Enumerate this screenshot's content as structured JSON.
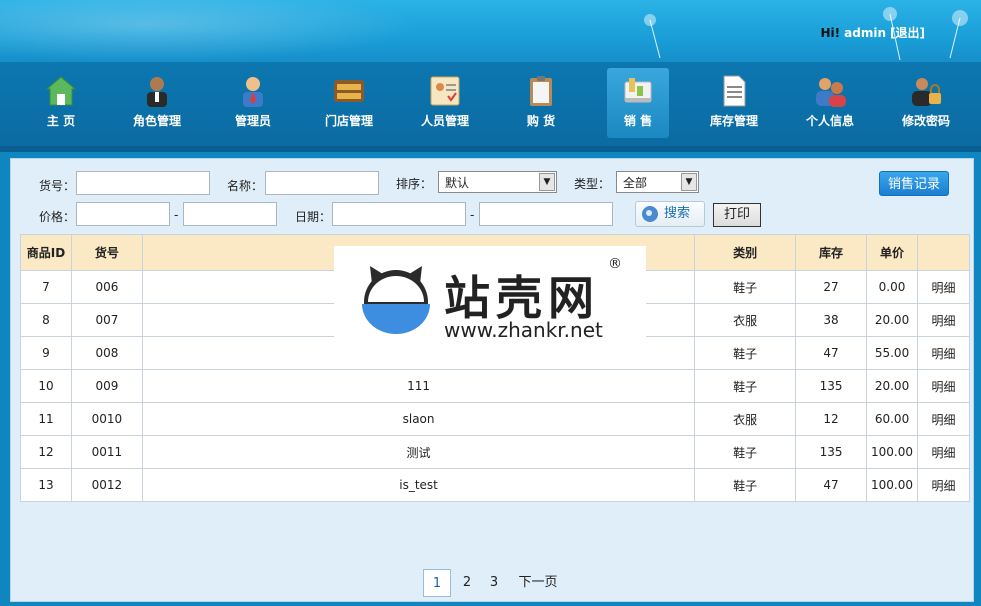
{
  "header": {
    "greeting": "Hi!",
    "username": "admin",
    "logout": "[退出]"
  },
  "nav": {
    "items": [
      {
        "label": "主  页",
        "icon": "home-icon",
        "active": false
      },
      {
        "label": "角色管理",
        "icon": "role-icon",
        "active": false
      },
      {
        "label": "管理员",
        "icon": "admin-icon",
        "active": false
      },
      {
        "label": "门店管理",
        "icon": "store-icon",
        "active": false
      },
      {
        "label": "人员管理",
        "icon": "staff-icon",
        "active": false
      },
      {
        "label": "购  货",
        "icon": "purchase-icon",
        "active": false
      },
      {
        "label": "销  售",
        "icon": "sales-icon",
        "active": true
      },
      {
        "label": "库存管理",
        "icon": "inventory-icon",
        "active": false
      },
      {
        "label": "个人信息",
        "icon": "profile-icon",
        "active": false
      },
      {
        "label": "修改密码",
        "icon": "password-icon",
        "active": false
      }
    ]
  },
  "filter": {
    "code_label": "货号：",
    "name_label": "名称：",
    "sort_label": "排序：",
    "sort_value": "默认",
    "type_label": "类型：",
    "type_value": "全部",
    "price_label": "价格：",
    "date_label": "日期：",
    "dash": "-",
    "search_button": "搜索",
    "print_button": "打印",
    "sales_record_button": "销售记录"
  },
  "table": {
    "headers": [
      "商品ID",
      "货号",
      "",
      "类别",
      "库存",
      "单价",
      ""
    ],
    "detail_label": "明细",
    "rows": [
      {
        "id": "7",
        "code": "006",
        "name": "",
        "category": "鞋子",
        "stock": "27",
        "price": "0.00"
      },
      {
        "id": "8",
        "code": "007",
        "name": "",
        "category": "衣服",
        "stock": "38",
        "price": "20.00"
      },
      {
        "id": "9",
        "code": "008",
        "name": "",
        "category": "鞋子",
        "stock": "47",
        "price": "55.00"
      },
      {
        "id": "10",
        "code": "009",
        "name": "111",
        "category": "鞋子",
        "stock": "135",
        "price": "20.00"
      },
      {
        "id": "11",
        "code": "0010",
        "name": "slaon",
        "category": "衣服",
        "stock": "12",
        "price": "60.00"
      },
      {
        "id": "12",
        "code": "0011",
        "name": "测试",
        "category": "鞋子",
        "stock": "135",
        "price": "100.00"
      },
      {
        "id": "13",
        "code": "0012",
        "name": "is_test",
        "category": "鞋子",
        "stock": "47",
        "price": "100.00"
      }
    ]
  },
  "watermark": {
    "text": "站壳网",
    "registered": "®",
    "url": "www.zhankr.net"
  },
  "pager": {
    "pages": [
      "1",
      "2",
      "3"
    ],
    "current": "1",
    "next": "下一页"
  },
  "colors": {
    "header_blue": "#1a9fd8",
    "nav_blue": "#0b6ba2",
    "table_header": "#fbe9c6",
    "link_blue": "#1c5fb0"
  }
}
